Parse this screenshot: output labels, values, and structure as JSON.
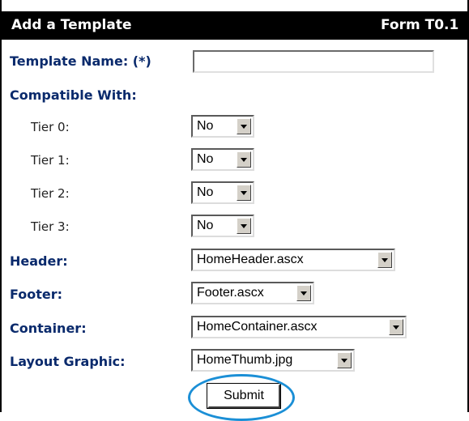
{
  "header": {
    "title": "Add a Template",
    "form_id": "Form T0.1"
  },
  "form": {
    "template_name_label": "Template Name: (*)",
    "template_name_value": "",
    "compatible_with_label": "Compatible With:",
    "tiers": [
      {
        "label": "Tier 0:",
        "value": "No"
      },
      {
        "label": "Tier 1:",
        "value": "No"
      },
      {
        "label": "Tier 2:",
        "value": "No"
      },
      {
        "label": "Tier 3:",
        "value": "No"
      }
    ],
    "header_label": "Header:",
    "header_value": "HomeHeader.ascx",
    "footer_label": "Footer:",
    "footer_value": "Footer.ascx",
    "container_label": "Container:",
    "container_value": "HomeContainer.ascx",
    "layout_graphic_label": "Layout Graphic:",
    "layout_graphic_value": "HomeThumb.jpg",
    "submit_label": "Submit"
  },
  "colors": {
    "titlebar_bg": "#000000",
    "label_color": "#0a2a6c",
    "highlight": "#1b8fd6"
  }
}
